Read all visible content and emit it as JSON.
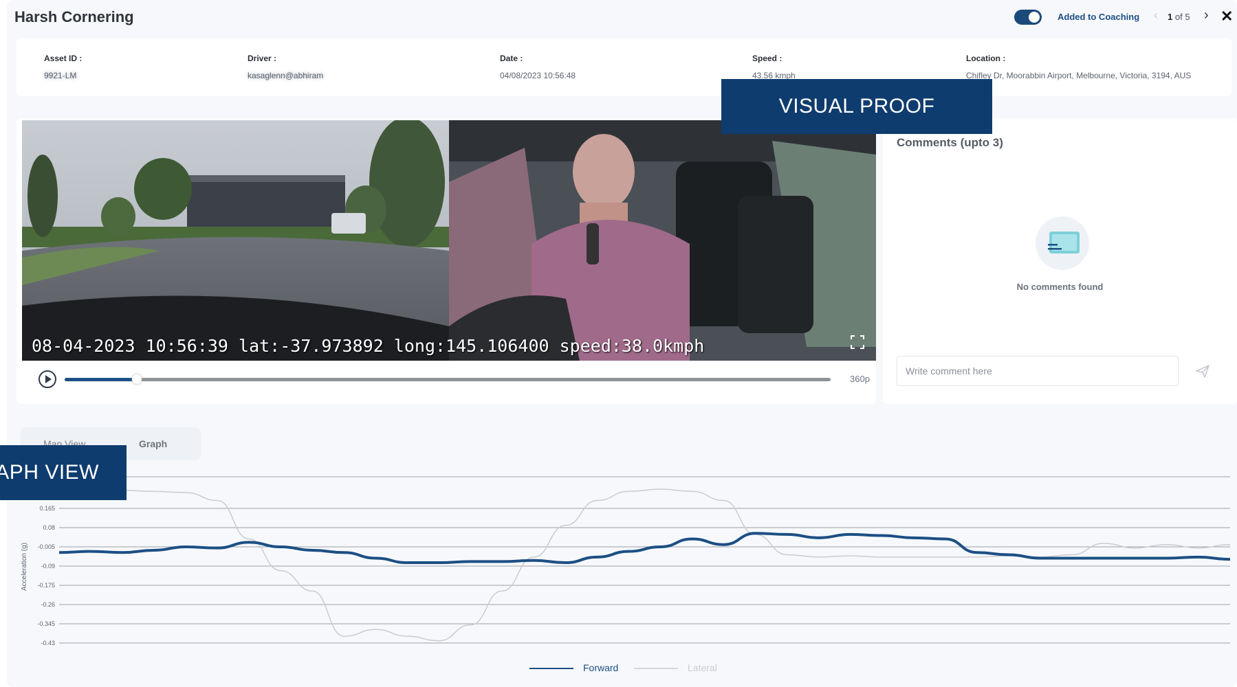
{
  "header": {
    "title": "Harsh Cornering",
    "coaching_label": "Added to Coaching",
    "coaching_enabled": true,
    "pager_current": "1",
    "pager_rest": "of 5"
  },
  "info": {
    "asset_label": "Asset ID :",
    "asset_value": "9921-LM",
    "driver_label": "Driver :",
    "driver_value": "kasaglenn@abhiram",
    "date_label": "Date :",
    "date_value": "04/08/2023 10:56:48",
    "speed_label": "Speed :",
    "speed_value": "43.56 kmph",
    "location_label": "Location :",
    "location_value": "Chifley Dr, Moorabbin Airport, Melbourne, Victoria, 3194, AUS"
  },
  "video": {
    "overlay_text": "08-04-2023 10:56:39 lat:-37.973892 long:145.106400 speed:38.0kmph",
    "quality": "360p",
    "progress": 0.092
  },
  "comments": {
    "title": "Comments (upto 3)",
    "empty_text": "No comments found",
    "input_placeholder": "Write comment here"
  },
  "tabs": {
    "map": "Map View",
    "graph": "Graph",
    "active": "Graph"
  },
  "banners": {
    "visual": "VISUAL PROOF",
    "graph": "GRAPH VIEW"
  },
  "colors": {
    "brand": "#0f3c6e",
    "forward": "#1c4f84",
    "lateral": "#c9ccd0"
  },
  "chart_data": {
    "type": "line",
    "ylabel": "Acceleration (g)",
    "yticks": [
      "0.165",
      "0.08",
      "-0.005",
      "-0.09",
      "-0.175",
      "-0.26",
      "-0.345",
      "-0.43"
    ],
    "ylim": [
      -0.43,
      0.25
    ],
    "grid": true,
    "legend_position": "bottom-center",
    "series": [
      {
        "name": "Forward",
        "color": "#1c4f84",
        "values": [
          -0.03,
          -0.025,
          -0.03,
          -0.02,
          -0.005,
          -0.01,
          0.015,
          -0.005,
          -0.02,
          -0.03,
          -0.055,
          -0.075,
          -0.075,
          -0.07,
          -0.07,
          -0.065,
          -0.075,
          -0.05,
          -0.025,
          -0.005,
          0.03,
          0.005,
          0.055,
          0.05,
          0.035,
          0.05,
          0.045,
          0.035,
          0.03,
          -0.03,
          -0.04,
          -0.055,
          -0.055,
          -0.055,
          -0.055,
          -0.055,
          -0.05,
          -0.06
        ]
      },
      {
        "name": "Lateral",
        "color": "#c9ccd0",
        "values": [
          0.245,
          0.245,
          0.245,
          0.24,
          0.235,
          0.2,
          0.03,
          -0.11,
          -0.2,
          -0.4,
          -0.37,
          -0.4,
          -0.42,
          -0.35,
          -0.2,
          -0.05,
          0.09,
          0.2,
          0.24,
          0.25,
          0.24,
          0.2,
          0.05,
          -0.04,
          -0.05,
          -0.045,
          -0.05,
          -0.05,
          -0.05,
          -0.05,
          -0.045,
          -0.05,
          -0.04,
          0.01,
          -0.01,
          0.005,
          -0.01,
          0.005
        ]
      }
    ]
  }
}
